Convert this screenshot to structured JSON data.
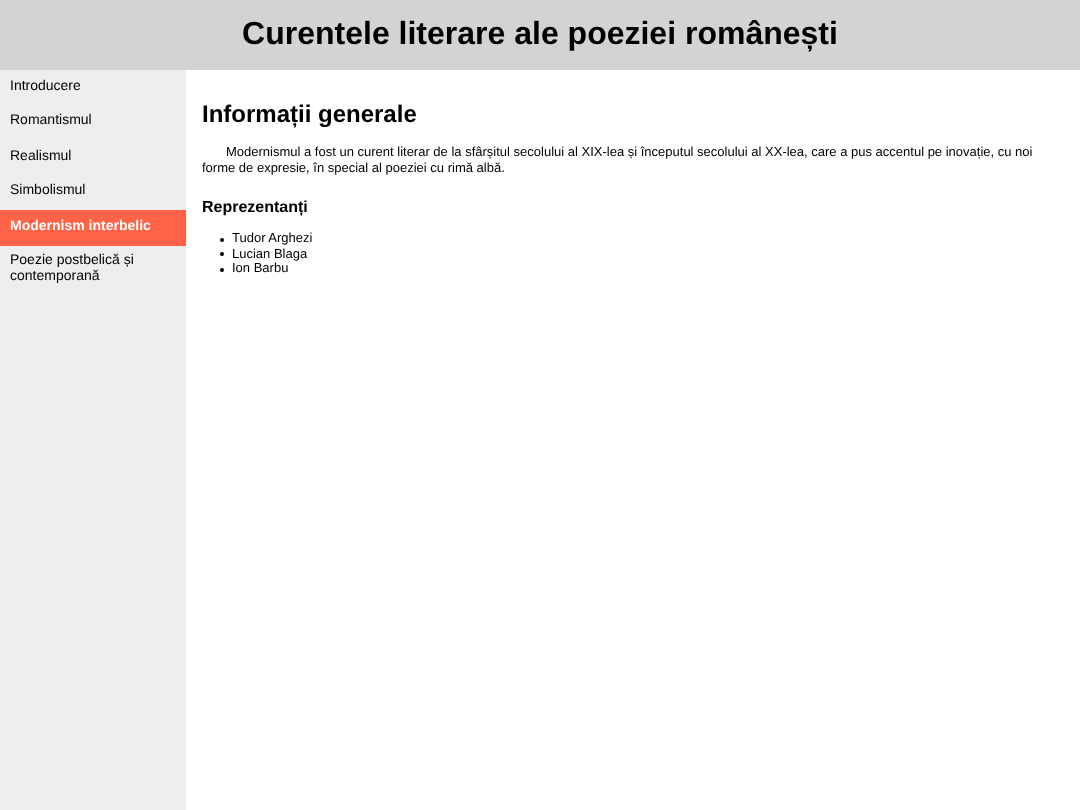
{
  "header": {
    "title": "Curentele literare ale poeziei românești"
  },
  "sidebar": {
    "items": [
      {
        "label": "Introducere",
        "selected": false
      },
      {
        "label": "Romantismul",
        "selected": false
      },
      {
        "label": "Realismul",
        "selected": false
      },
      {
        "label": "Simbolismul",
        "selected": false
      },
      {
        "label": "Modernism interbelic",
        "selected": true
      },
      {
        "label": "Poezie postbelică și contemporană",
        "selected": false
      }
    ]
  },
  "content": {
    "heading": "Informații generale",
    "paragraph": "Modernismul a fost un curent literar de la sfârșitul secolului al XIX-lea și începutul secolului al XX-lea, care a pus accentul pe inovație, cu noi forme de expresie, în special al poeziei cu rimă albă.",
    "subheading": "Reprezentanți",
    "list": [
      "Tudor Arghezi",
      "Lucian Blaga",
      "Ion Barbu"
    ]
  }
}
